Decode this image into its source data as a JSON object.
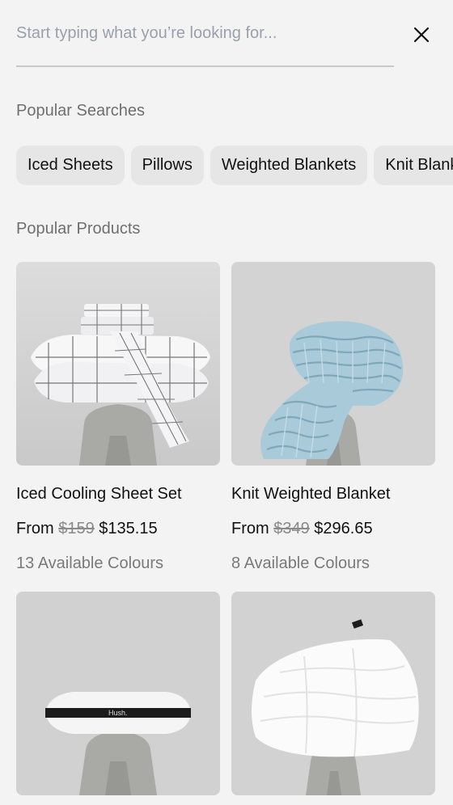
{
  "search": {
    "placeholder": "Start typing what you’re looking for...",
    "value": ""
  },
  "popular_searches": {
    "title": "Popular Searches",
    "chips": [
      "Iced Sheets",
      "Pillows",
      "Weighted Blankets",
      "Knit Blanket"
    ]
  },
  "popular_products": {
    "title": "Popular Products",
    "items": [
      {
        "name": "Iced Cooling Sheet Set",
        "price_prefix": "From",
        "old_price": "$159",
        "price": "$135.15",
        "colours": "13 Available Colours",
        "image": "striped-sheet-set-on-stand"
      },
      {
        "name": "Knit Weighted Blanket",
        "price_prefix": "From",
        "old_price": "$349",
        "price": "$296.65",
        "colours": "8 Available Colours",
        "image": "blue-knit-blanket-on-stand"
      },
      {
        "name": "",
        "image": "pillow-on-stand",
        "brand_text": "Hush."
      },
      {
        "name": "",
        "image": "white-duvet-on-stand"
      }
    ]
  },
  "icons": {
    "close": "close-icon"
  },
  "colors": {
    "background": "#f3f3f3",
    "chip": "#e6e6e6",
    "muted": "#6f6f6f",
    "placeholder": "#9aa0ab"
  }
}
